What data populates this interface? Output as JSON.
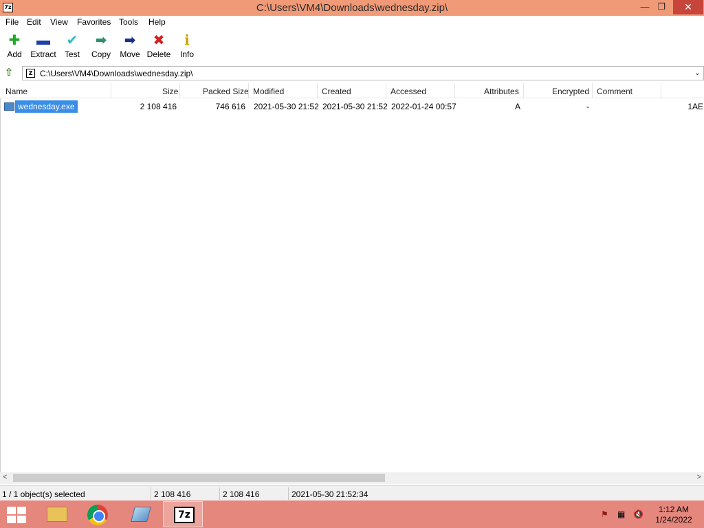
{
  "window": {
    "title": "C:\\Users\\VM4\\Downloads\\wednesday.zip\\",
    "app_icon_text": "7z",
    "minimize_glyph": "—",
    "maximize_glyph": "❐",
    "close_glyph": "✕"
  },
  "menu": [
    "File",
    "Edit",
    "View",
    "Favorites",
    "Tools",
    "Help"
  ],
  "toolbar": [
    {
      "label": "Add",
      "icon": "plus-icon",
      "glyph": "✚",
      "color": "#1fa824"
    },
    {
      "label": "Extract",
      "icon": "minus-icon",
      "glyph": "▬",
      "color": "#1d3fa8"
    },
    {
      "label": "Test",
      "icon": "check-icon",
      "glyph": "✔",
      "color": "#2fb8c0"
    },
    {
      "label": "Copy",
      "icon": "copy-arrow-icon",
      "glyph": "➡",
      "color": "#2c8f6e"
    },
    {
      "label": "Move",
      "icon": "move-arrow-icon",
      "glyph": "➡",
      "color": "#1a2f8c"
    },
    {
      "label": "Delete",
      "icon": "delete-x-icon",
      "glyph": "✖",
      "color": "#d42020"
    },
    {
      "label": "Info",
      "icon": "info-icon",
      "glyph": "ℹ",
      "color": "#c9a400"
    }
  ],
  "address": {
    "path": "C:\\Users\\VM4\\Downloads\\wednesday.zip\\",
    "icon_text": "Z",
    "up_glyph": "⇧",
    "dropdown_glyph": "⌄"
  },
  "columns": [
    "Name",
    "Size",
    "Packed Size",
    "Modified",
    "Created",
    "Accessed",
    "Attributes",
    "Encrypted",
    "Comment"
  ],
  "files": [
    {
      "name": "wednesday.exe",
      "size": "2 108 416",
      "packed_size": "746 616",
      "modified": "2021-05-30 21:52",
      "created": "2021-05-30 21:52",
      "accessed": "2022-01-24 00:57",
      "attributes": "A",
      "encrypted": "-",
      "comment": "",
      "crc_truncated": "1AE"
    }
  ],
  "scroll": {
    "left": "<",
    "right": ">"
  },
  "status": {
    "selection": "1 / 1 object(s) selected",
    "size": "2 108 416",
    "packed": "2 108 416",
    "modified": "2021-05-30 21:52:34"
  },
  "taskbar": {
    "apps": [
      "file-explorer",
      "chrome",
      "tablet-app",
      "7-zip"
    ],
    "sevenzip_text": "7z",
    "clock_time": "1:12 AM",
    "clock_date": "1/24/2022",
    "tray_flag": "⚑",
    "tray_network": "▦",
    "tray_volume": "🔇"
  },
  "colors": {
    "titlebar": "#f09a78",
    "taskbar": "#e6877d",
    "selection": "#3a8ee6",
    "close": "#c7453a"
  }
}
